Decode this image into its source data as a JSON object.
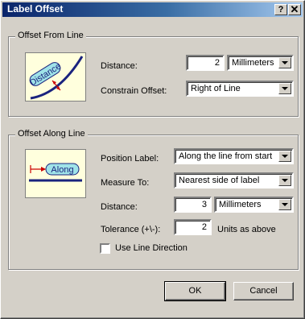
{
  "window": {
    "title": "Label Offset",
    "help_glyph": "?",
    "close_glyph": "✕"
  },
  "offset_from_line": {
    "group_title": "Offset From Line",
    "illustration_text": "Distance",
    "distance_label": "Distance:",
    "distance_value": "2",
    "distance_units": "Millimeters",
    "constrain_label": "Constrain Offset:",
    "constrain_value": "Right of Line"
  },
  "offset_along_line": {
    "group_title": "Offset Along Line",
    "illustration_text": "Along",
    "position_label": "Position Label:",
    "position_value": "Along the line from start",
    "measure_label": "Measure To:",
    "measure_value": "Nearest side of label",
    "distance_label": "Distance:",
    "distance_value": "3",
    "distance_units": "Millimeters",
    "tolerance_label": "Tolerance (+\\-):",
    "tolerance_value": "2",
    "tolerance_units": "Units as above",
    "use_line_direction_label": "Use Line Direction"
  },
  "buttons": {
    "ok": "OK",
    "cancel": "Cancel"
  },
  "colors": {
    "title_start": "#0a246a",
    "title_end": "#a6caf0",
    "face": "#d4d0c8",
    "illustration_bg": "#ffffdd",
    "line": "#1a237e",
    "arrow": "#cc0000"
  }
}
